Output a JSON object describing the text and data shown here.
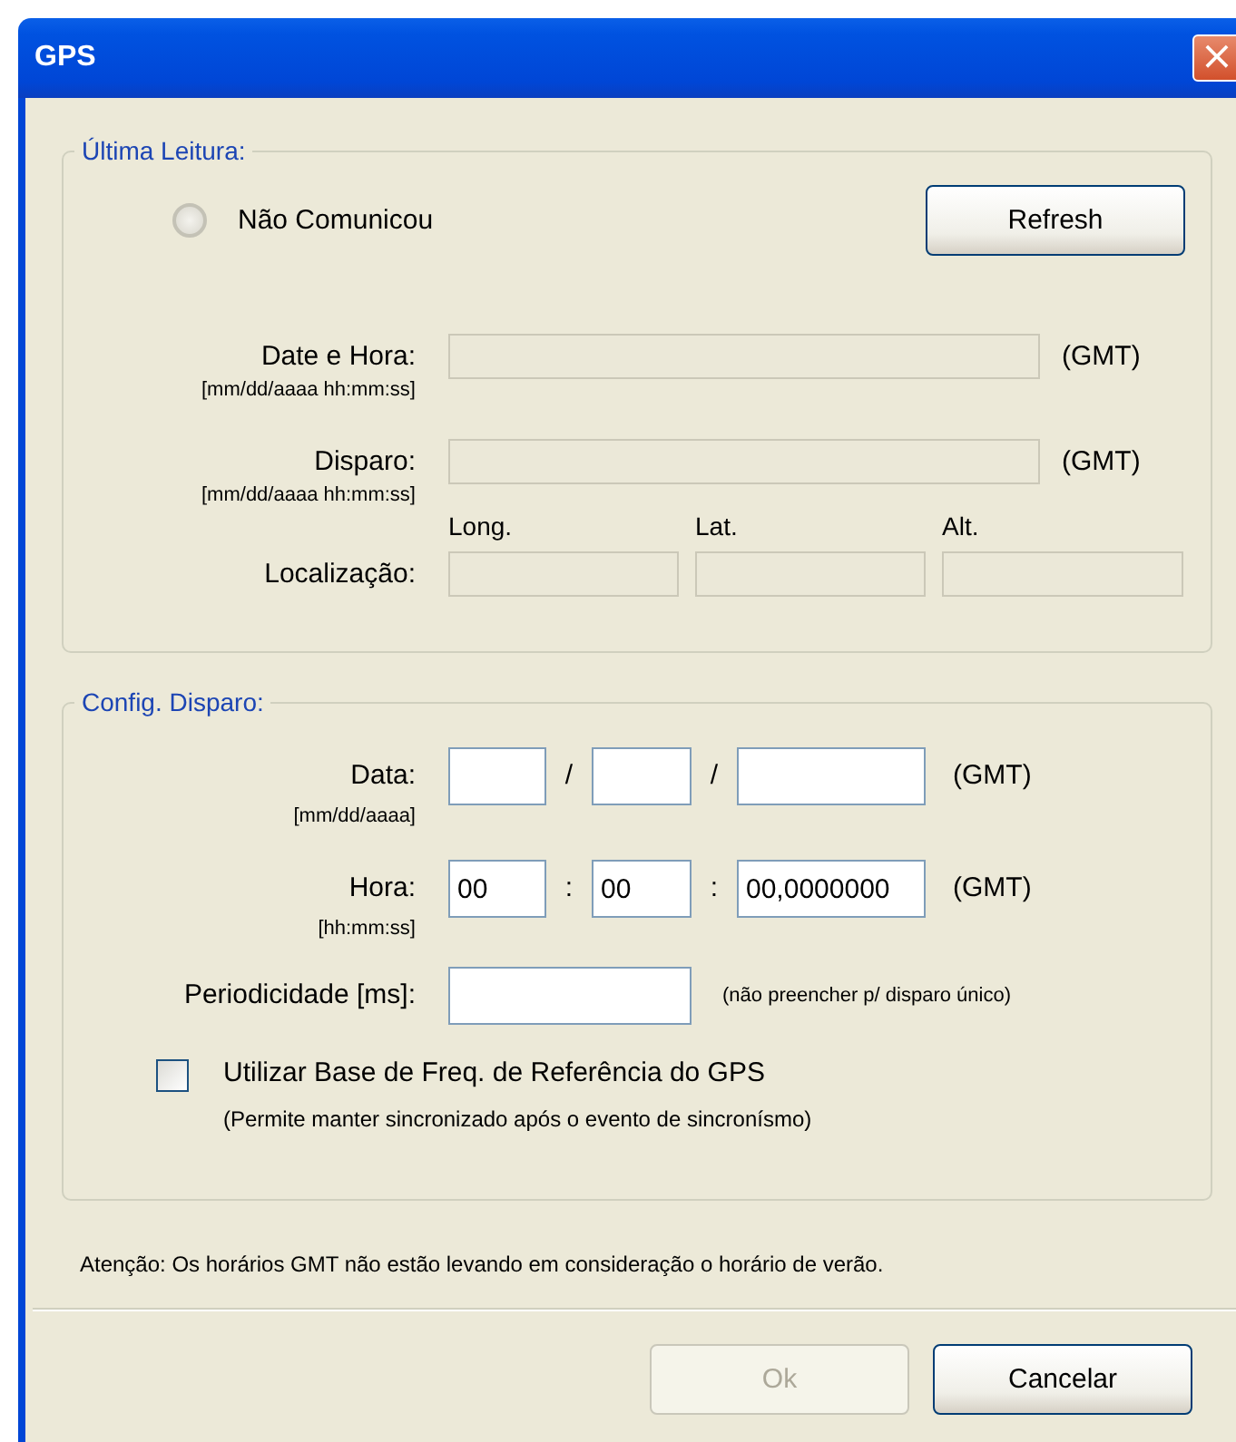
{
  "window": {
    "title": "GPS",
    "close": "×"
  },
  "last_reading": {
    "legend": "Última Leitura:",
    "status": {
      "label": "Não Comunicou",
      "on": false
    },
    "refresh_button": "Refresh",
    "fields": [
      {
        "label": "Date e Hora:",
        "format": "[mm/dd/aaaa hh:mm:ss]",
        "unit": "(GMT)",
        "disabled": true
      },
      {
        "label": "Disparo:",
        "format": "[mm/dd/aaaa hh:mm:ss]",
        "unit": "(GMT)",
        "disabled": true
      }
    ],
    "location": {
      "label": "Localização:",
      "columns": [
        {
          "header": "Long.",
          "disabled": true
        },
        {
          "header": "Lat.",
          "disabled": true
        },
        {
          "header": "Alt.",
          "disabled": true
        }
      ]
    }
  },
  "trigger_config": {
    "legend": "Config. Disparo:",
    "date": {
      "label": "Data:",
      "format": "[mm/dd/aaaa]",
      "separators": [
        "/",
        "/"
      ],
      "unit": "(GMT)"
    },
    "time": {
      "label": "Hora:",
      "format": "[hh:mm:ss]",
      "separators": [
        ":",
        ":"
      ],
      "values": [
        "00",
        "00",
        "00,0000000"
      ],
      "unit": "(GMT)"
    },
    "period": {
      "label": "Periodicidade [ms]:",
      "hint": "(não preencher p/ disparo único)"
    },
    "gps_reference": {
      "label": "Utilizar Base de Freq. de Referência do GPS",
      "note": "(Permite manter sincronizado após o evento de sincronísmo)",
      "checked": false
    }
  },
  "notice": "Atenção: Os horários GMT não estão levando em consideração o horário de verão.",
  "buttons": [
    {
      "label": "Ok",
      "disabled": true
    },
    {
      "label": "Cancelar",
      "disabled": false
    }
  ]
}
